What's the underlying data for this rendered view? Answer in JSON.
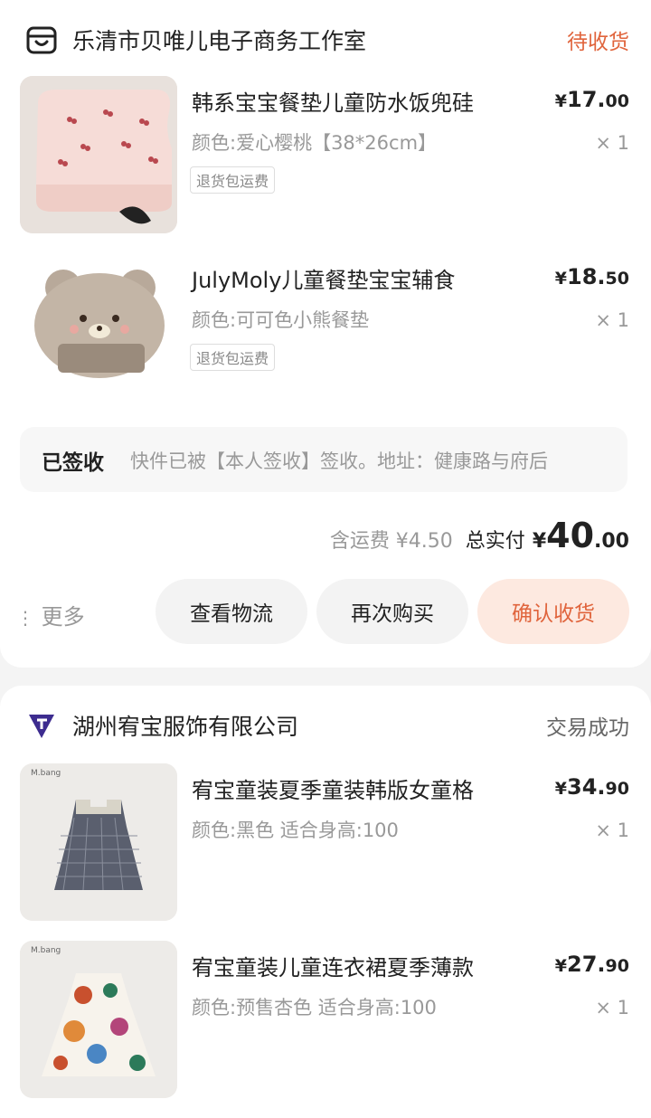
{
  "colors": {
    "accent": "#e0643c",
    "muted": "#999999",
    "page_bg": "#f4f4f4"
  },
  "order1": {
    "shop_name": "乐清市贝唯儿电子商务工作室",
    "shop_icon": "shop-bag-icon",
    "status": "待收货",
    "items": [
      {
        "title": "韩系宝宝餐垫儿童防水饭兜硅",
        "variant": "颜色:爱心樱桃【38*26cm】",
        "tag": "退货包运费",
        "price_currency": "¥",
        "price_int": "17.",
        "price_dec": "00",
        "qty": "× 1"
      },
      {
        "title": "JulyMoly儿童餐垫宝宝辅食",
        "variant": "颜色:可可色小熊餐垫",
        "tag": "退货包运费",
        "price_currency": "¥",
        "price_int": "18.",
        "price_dec": "50",
        "qty": "× 1"
      }
    ],
    "tracking": {
      "status": "已签收",
      "message": "快件已被【本人签收】签收。地址：健康路与府后"
    },
    "shipping": "含运费 ¥4.50",
    "total_label": "总实付",
    "total_currency": "¥",
    "total_int": "40",
    "total_dec": ".00",
    "more_label": "更多",
    "buttons": {
      "logistics": "查看物流",
      "rebuy": "再次购买",
      "confirm": "确认收货"
    }
  },
  "order2": {
    "shop_name": "湖州宥宝服饰有限公司",
    "shop_icon": "brand-logo-icon",
    "status": "交易成功",
    "items": [
      {
        "title": "宥宝童装夏季童装韩版女童格",
        "variant": "颜色:黑色 适合身高:100",
        "price_currency": "¥",
        "price_int": "34.",
        "price_dec": "90",
        "qty": "× 1",
        "thumb_brand": "M.bang"
      },
      {
        "title": "宥宝童装儿童连衣裙夏季薄款",
        "variant": "颜色:预售杏色 适合身高:100",
        "price_currency": "¥",
        "price_int": "27.",
        "price_dec": "90",
        "qty": "× 1",
        "thumb_brand": "M.bang"
      }
    ]
  }
}
